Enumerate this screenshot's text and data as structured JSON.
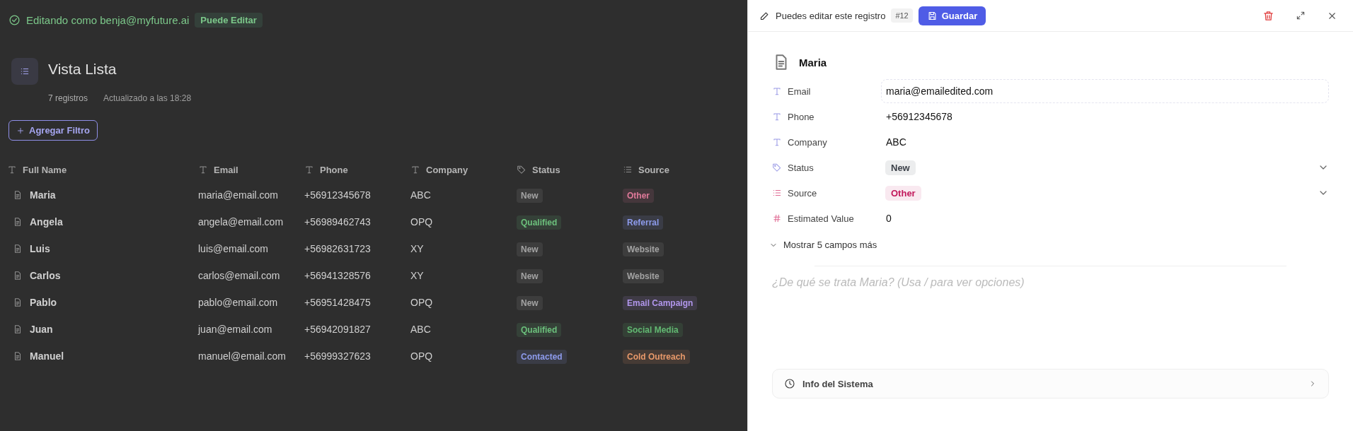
{
  "banner": {
    "text": "Editando como benja@myfuture.ai",
    "badge": "Puede Editar"
  },
  "view": {
    "title": "Vista Lista",
    "count": "7 registros",
    "updated": "Actualizado a las 18:28"
  },
  "filter_button": "Agregar Filtro",
  "table": {
    "columns": [
      {
        "label": "Full Name",
        "kind": "text"
      },
      {
        "label": "Email",
        "kind": "text"
      },
      {
        "label": "Phone",
        "kind": "text"
      },
      {
        "label": "Company",
        "kind": "text"
      },
      {
        "label": "Status",
        "kind": "tag"
      },
      {
        "label": "Source",
        "kind": "list"
      }
    ],
    "rows": [
      {
        "name": "Maria",
        "email": "maria@email.com",
        "phone": "+56912345678",
        "company": "ABC",
        "status": {
          "label": "New",
          "color": "#a3a3a3"
        },
        "source": {
          "label": "Other",
          "color": "#e07a9a"
        }
      },
      {
        "name": "Angela",
        "email": "angela@email.com",
        "phone": "+56989462743",
        "company": "OPQ",
        "status": {
          "label": "Qualified",
          "color": "#6cc07c"
        },
        "source": {
          "label": "Referral",
          "color": "#8d9bec"
        }
      },
      {
        "name": "Luis",
        "email": "luis@email.com",
        "phone": "+56982631723",
        "company": "XY",
        "status": {
          "label": "New",
          "color": "#a3a3a3"
        },
        "source": {
          "label": "Website",
          "color": "#a3a3a3"
        }
      },
      {
        "name": "Carlos",
        "email": "carlos@email.com",
        "phone": "+56941328576",
        "company": "XY",
        "status": {
          "label": "New",
          "color": "#a3a3a3"
        },
        "source": {
          "label": "Website",
          "color": "#a3a3a3"
        }
      },
      {
        "name": "Pablo",
        "email": "pablo@email.com",
        "phone": "+56951428475",
        "company": "OPQ",
        "status": {
          "label": "New",
          "color": "#a3a3a3"
        },
        "source": {
          "label": "Email Campaign",
          "color": "#b196ec"
        }
      },
      {
        "name": "Juan",
        "email": "juan@email.com",
        "phone": "+56942091827",
        "company": "ABC",
        "status": {
          "label": "Qualified",
          "color": "#6cc07c"
        },
        "source": {
          "label": "Social Media",
          "color": "#62b872"
        }
      },
      {
        "name": "Manuel",
        "email": "manuel@email.com",
        "phone": "+56999327623",
        "company": "OPQ",
        "status": {
          "label": "Contacted",
          "color": "#8d9bec"
        },
        "source": {
          "label": "Cold Outreach",
          "color": "#e8996a"
        }
      }
    ]
  },
  "panel": {
    "edit_note": "Puedes editar este registro",
    "record_id": "#12",
    "save_button": "Guardar",
    "record_title": "Maria",
    "fields": [
      {
        "label": "Email",
        "kind": "text",
        "value": "maria@emailedited.com",
        "editing": true
      },
      {
        "label": "Phone",
        "kind": "text",
        "value": "+56912345678",
        "editing": false
      },
      {
        "label": "Company",
        "kind": "text",
        "value": "ABC",
        "editing": false
      },
      {
        "label": "Status",
        "kind": "tag",
        "value": "New",
        "color": "#3a3f47"
      },
      {
        "label": "Source",
        "kind": "list",
        "value": "Other",
        "color": "#c2185b"
      },
      {
        "label": "Estimated Value",
        "kind": "number",
        "value": "0",
        "editing": false
      }
    ],
    "more_fields": "Mostrar 5 campos más",
    "notes": {
      "placeholder": "¿De qué se trata Maria? (Usa / para ver opciones)"
    },
    "system_info": "Info del Sistema"
  }
}
